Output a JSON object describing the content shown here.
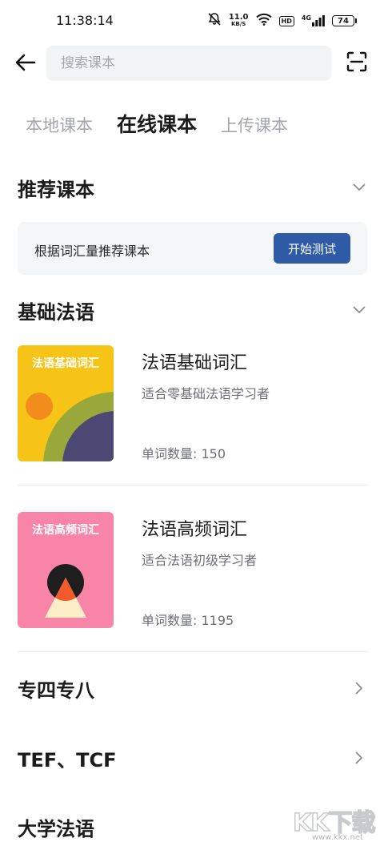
{
  "status": {
    "time": "11:38:14",
    "net_speed": "11.0",
    "net_unit": "KB/S",
    "network_type": "4G",
    "battery": "74",
    "icons": [
      "mute-icon",
      "wifi-icon",
      "hd-icon",
      "signal-icon",
      "battery-icon"
    ]
  },
  "header": {
    "back_icon": "arrow-left-icon",
    "search_placeholder": "搜索课本",
    "scan_icon": "scan-icon"
  },
  "tabs": [
    {
      "label": "本地课本",
      "active": false
    },
    {
      "label": "在线课本",
      "active": true
    },
    {
      "label": "上传课本",
      "active": false
    }
  ],
  "recommend": {
    "title": "推荐课本",
    "text": "根据词汇量推荐课本",
    "button": "开始测试"
  },
  "basic_section": {
    "title": "基础法语",
    "books": [
      {
        "cover_title": "法语基础词汇",
        "title": "法语基础词汇",
        "desc": "适合零基础法语学习者",
        "count": "单词数量: 150",
        "cover_colors": [
          "#f6c417",
          "#f28c1c",
          "#98a83a",
          "#4c4873"
        ]
      },
      {
        "cover_title": "法语高频词汇",
        "title": "法语高频词汇",
        "desc": "适合法语初级学习者",
        "count": "单词数量: 1195",
        "cover_colors": [
          "#f884a8",
          "#1e1e1e",
          "#f25a2c",
          "#fbedc5"
        ]
      }
    ]
  },
  "list": [
    {
      "label": "专四专八"
    },
    {
      "label": "TEF、TCF"
    },
    {
      "label": "大学法语"
    }
  ],
  "watermark": {
    "logo": "KK下载",
    "url": "www.kkx.net"
  },
  "colors": {
    "accent": "#2e5aa6",
    "muted_text": "#6e6f73",
    "tab_inactive": "#a4a6ab",
    "card_bg": "#f4f5f7"
  }
}
